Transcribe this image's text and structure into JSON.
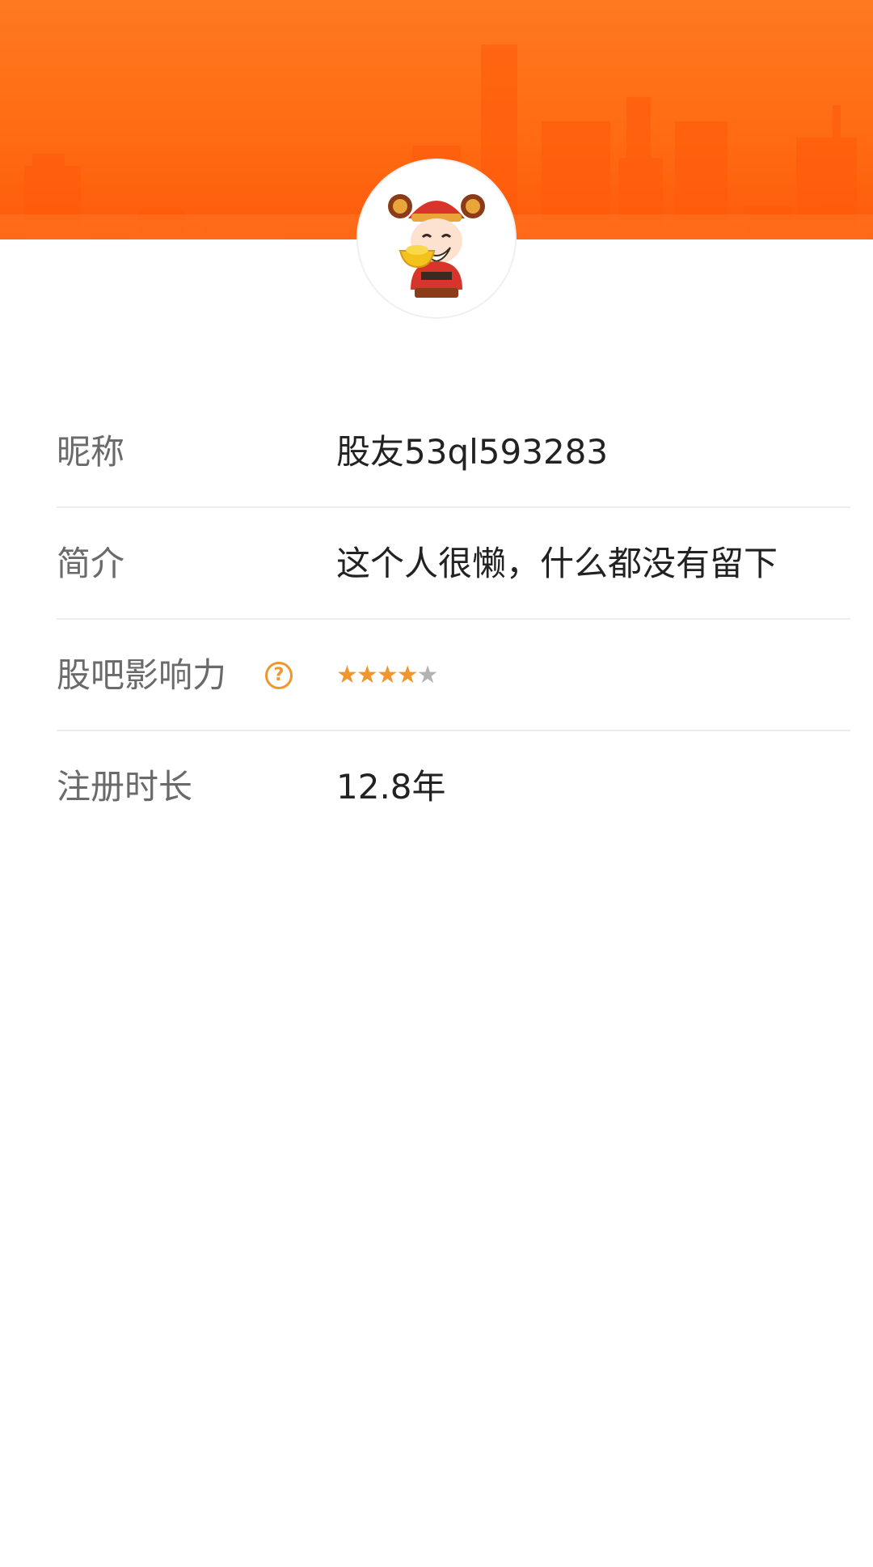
{
  "profile": {
    "nickname_label": "昵称",
    "nickname_value": "股友53ql593283",
    "bio_label": "简介",
    "bio_value": "这个人很懒，什么都没有留下",
    "influence_label": "股吧影响力",
    "influence_rating": 4,
    "influence_max": 5,
    "influence_help_glyph": "?",
    "tenure_label": "注册时长",
    "tenure_value": "12.8年"
  },
  "icons": {
    "banner": "city-skyline-banner",
    "avatar": "god-of-wealth-avatar",
    "help": "question-circle-icon",
    "star": "star-icon"
  },
  "colors": {
    "banner_orange": "#ff6a12",
    "star_filled": "#f0962c",
    "star_empty": "#b3b3b3",
    "label_text": "#6a6a6a",
    "value_text": "#222222"
  }
}
